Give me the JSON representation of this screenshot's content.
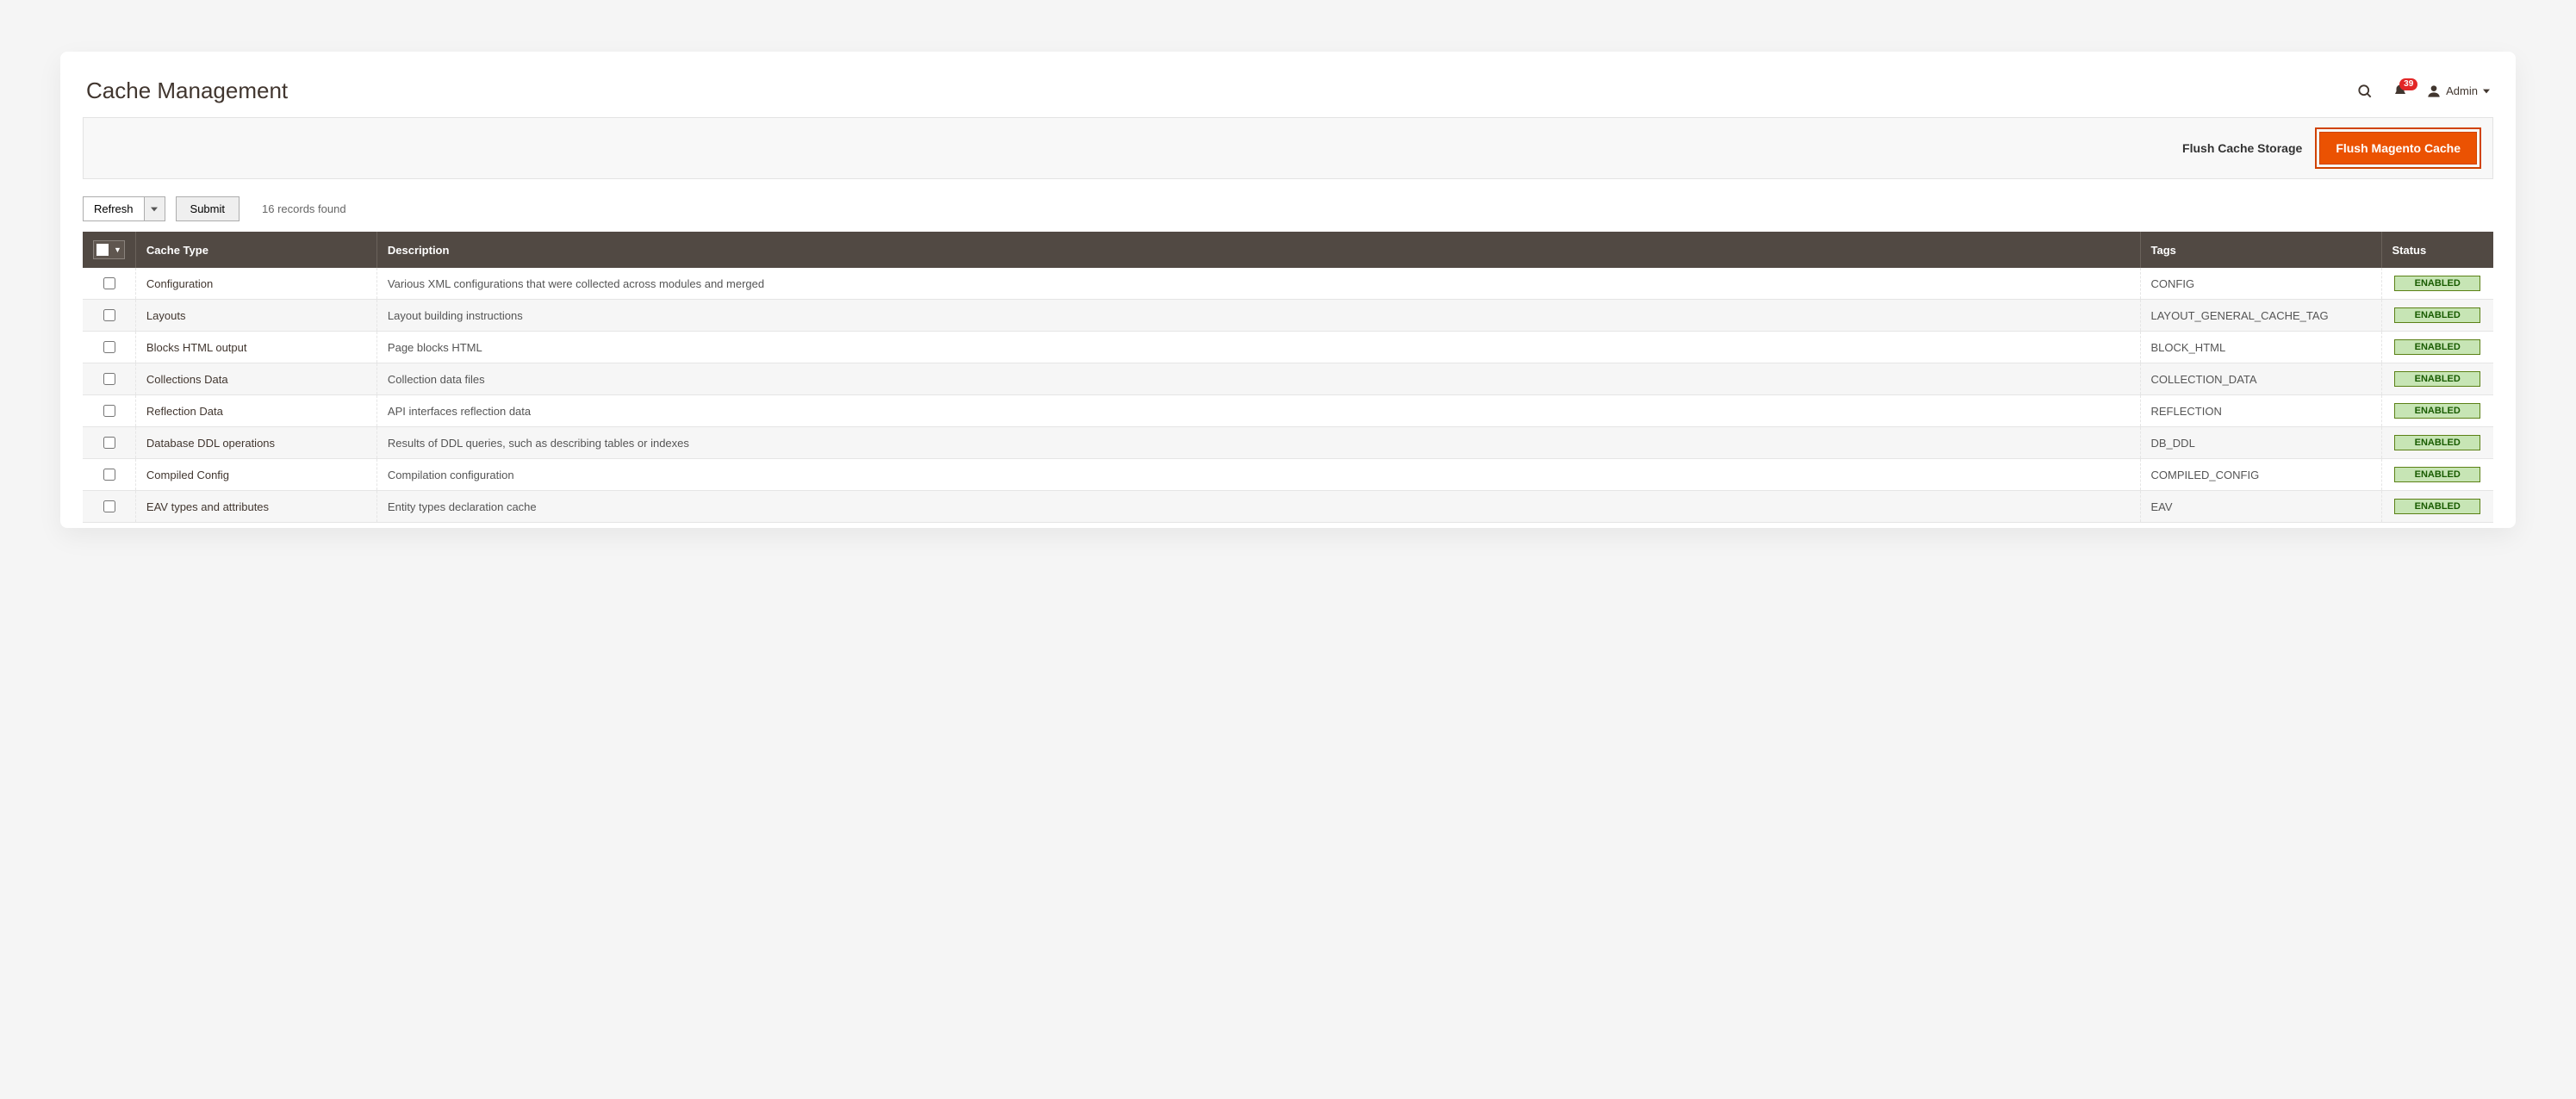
{
  "page_title": "Cache Management",
  "header": {
    "notification_count": "39",
    "admin_label": "Admin"
  },
  "action_bar": {
    "flush_storage_label": "Flush Cache Storage",
    "flush_magento_label": "Flush Magento Cache"
  },
  "toolbar": {
    "refresh_label": "Refresh",
    "submit_label": "Submit",
    "records_found": "16 records found"
  },
  "table": {
    "headers": {
      "cache_type": "Cache Type",
      "description": "Description",
      "tags": "Tags",
      "status": "Status"
    },
    "status_enabled": "ENABLED",
    "rows": [
      {
        "type": "Configuration",
        "desc": "Various XML configurations that were collected across modules and merged",
        "tags": "CONFIG"
      },
      {
        "type": "Layouts",
        "desc": "Layout building instructions",
        "tags": "LAYOUT_GENERAL_CACHE_TAG"
      },
      {
        "type": "Blocks HTML output",
        "desc": "Page blocks HTML",
        "tags": "BLOCK_HTML"
      },
      {
        "type": "Collections Data",
        "desc": "Collection data files",
        "tags": "COLLECTION_DATA"
      },
      {
        "type": "Reflection Data",
        "desc": "API interfaces reflection data",
        "tags": "REFLECTION"
      },
      {
        "type": "Database DDL operations",
        "desc": "Results of DDL queries, such as describing tables or indexes",
        "tags": "DB_DDL"
      },
      {
        "type": "Compiled Config",
        "desc": "Compilation configuration",
        "tags": "COMPILED_CONFIG"
      },
      {
        "type": "EAV types and attributes",
        "desc": "Entity types declaration cache",
        "tags": "EAV"
      }
    ]
  }
}
